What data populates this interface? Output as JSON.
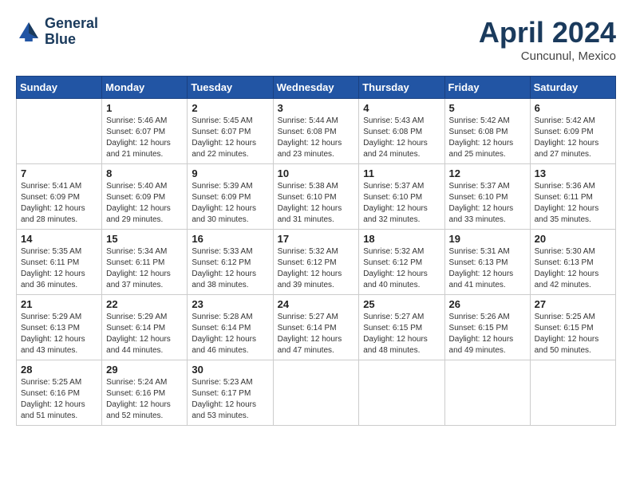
{
  "logo": {
    "line1": "General",
    "line2": "Blue"
  },
  "title": "April 2024",
  "subtitle": "Cuncunul, Mexico",
  "days_of_week": [
    "Sunday",
    "Monday",
    "Tuesday",
    "Wednesday",
    "Thursday",
    "Friday",
    "Saturday"
  ],
  "weeks": [
    [
      {
        "day": "",
        "sunrise": "",
        "sunset": "",
        "daylight": ""
      },
      {
        "day": "1",
        "sunrise": "Sunrise: 5:46 AM",
        "sunset": "Sunset: 6:07 PM",
        "daylight": "Daylight: 12 hours and 21 minutes."
      },
      {
        "day": "2",
        "sunrise": "Sunrise: 5:45 AM",
        "sunset": "Sunset: 6:07 PM",
        "daylight": "Daylight: 12 hours and 22 minutes."
      },
      {
        "day": "3",
        "sunrise": "Sunrise: 5:44 AM",
        "sunset": "Sunset: 6:08 PM",
        "daylight": "Daylight: 12 hours and 23 minutes."
      },
      {
        "day": "4",
        "sunrise": "Sunrise: 5:43 AM",
        "sunset": "Sunset: 6:08 PM",
        "daylight": "Daylight: 12 hours and 24 minutes."
      },
      {
        "day": "5",
        "sunrise": "Sunrise: 5:42 AM",
        "sunset": "Sunset: 6:08 PM",
        "daylight": "Daylight: 12 hours and 25 minutes."
      },
      {
        "day": "6",
        "sunrise": "Sunrise: 5:42 AM",
        "sunset": "Sunset: 6:09 PM",
        "daylight": "Daylight: 12 hours and 27 minutes."
      }
    ],
    [
      {
        "day": "7",
        "sunrise": "Sunrise: 5:41 AM",
        "sunset": "Sunset: 6:09 PM",
        "daylight": "Daylight: 12 hours and 28 minutes."
      },
      {
        "day": "8",
        "sunrise": "Sunrise: 5:40 AM",
        "sunset": "Sunset: 6:09 PM",
        "daylight": "Daylight: 12 hours and 29 minutes."
      },
      {
        "day": "9",
        "sunrise": "Sunrise: 5:39 AM",
        "sunset": "Sunset: 6:09 PM",
        "daylight": "Daylight: 12 hours and 30 minutes."
      },
      {
        "day": "10",
        "sunrise": "Sunrise: 5:38 AM",
        "sunset": "Sunset: 6:10 PM",
        "daylight": "Daylight: 12 hours and 31 minutes."
      },
      {
        "day": "11",
        "sunrise": "Sunrise: 5:37 AM",
        "sunset": "Sunset: 6:10 PM",
        "daylight": "Daylight: 12 hours and 32 minutes."
      },
      {
        "day": "12",
        "sunrise": "Sunrise: 5:37 AM",
        "sunset": "Sunset: 6:10 PM",
        "daylight": "Daylight: 12 hours and 33 minutes."
      },
      {
        "day": "13",
        "sunrise": "Sunrise: 5:36 AM",
        "sunset": "Sunset: 6:11 PM",
        "daylight": "Daylight: 12 hours and 35 minutes."
      }
    ],
    [
      {
        "day": "14",
        "sunrise": "Sunrise: 5:35 AM",
        "sunset": "Sunset: 6:11 PM",
        "daylight": "Daylight: 12 hours and 36 minutes."
      },
      {
        "day": "15",
        "sunrise": "Sunrise: 5:34 AM",
        "sunset": "Sunset: 6:11 PM",
        "daylight": "Daylight: 12 hours and 37 minutes."
      },
      {
        "day": "16",
        "sunrise": "Sunrise: 5:33 AM",
        "sunset": "Sunset: 6:12 PM",
        "daylight": "Daylight: 12 hours and 38 minutes."
      },
      {
        "day": "17",
        "sunrise": "Sunrise: 5:32 AM",
        "sunset": "Sunset: 6:12 PM",
        "daylight": "Daylight: 12 hours and 39 minutes."
      },
      {
        "day": "18",
        "sunrise": "Sunrise: 5:32 AM",
        "sunset": "Sunset: 6:12 PM",
        "daylight": "Daylight: 12 hours and 40 minutes."
      },
      {
        "day": "19",
        "sunrise": "Sunrise: 5:31 AM",
        "sunset": "Sunset: 6:13 PM",
        "daylight": "Daylight: 12 hours and 41 minutes."
      },
      {
        "day": "20",
        "sunrise": "Sunrise: 5:30 AM",
        "sunset": "Sunset: 6:13 PM",
        "daylight": "Daylight: 12 hours and 42 minutes."
      }
    ],
    [
      {
        "day": "21",
        "sunrise": "Sunrise: 5:29 AM",
        "sunset": "Sunset: 6:13 PM",
        "daylight": "Daylight: 12 hours and 43 minutes."
      },
      {
        "day": "22",
        "sunrise": "Sunrise: 5:29 AM",
        "sunset": "Sunset: 6:14 PM",
        "daylight": "Daylight: 12 hours and 44 minutes."
      },
      {
        "day": "23",
        "sunrise": "Sunrise: 5:28 AM",
        "sunset": "Sunset: 6:14 PM",
        "daylight": "Daylight: 12 hours and 46 minutes."
      },
      {
        "day": "24",
        "sunrise": "Sunrise: 5:27 AM",
        "sunset": "Sunset: 6:14 PM",
        "daylight": "Daylight: 12 hours and 47 minutes."
      },
      {
        "day": "25",
        "sunrise": "Sunrise: 5:27 AM",
        "sunset": "Sunset: 6:15 PM",
        "daylight": "Daylight: 12 hours and 48 minutes."
      },
      {
        "day": "26",
        "sunrise": "Sunrise: 5:26 AM",
        "sunset": "Sunset: 6:15 PM",
        "daylight": "Daylight: 12 hours and 49 minutes."
      },
      {
        "day": "27",
        "sunrise": "Sunrise: 5:25 AM",
        "sunset": "Sunset: 6:15 PM",
        "daylight": "Daylight: 12 hours and 50 minutes."
      }
    ],
    [
      {
        "day": "28",
        "sunrise": "Sunrise: 5:25 AM",
        "sunset": "Sunset: 6:16 PM",
        "daylight": "Daylight: 12 hours and 51 minutes."
      },
      {
        "day": "29",
        "sunrise": "Sunrise: 5:24 AM",
        "sunset": "Sunset: 6:16 PM",
        "daylight": "Daylight: 12 hours and 52 minutes."
      },
      {
        "day": "30",
        "sunrise": "Sunrise: 5:23 AM",
        "sunset": "Sunset: 6:17 PM",
        "daylight": "Daylight: 12 hours and 53 minutes."
      },
      {
        "day": "",
        "sunrise": "",
        "sunset": "",
        "daylight": ""
      },
      {
        "day": "",
        "sunrise": "",
        "sunset": "",
        "daylight": ""
      },
      {
        "day": "",
        "sunrise": "",
        "sunset": "",
        "daylight": ""
      },
      {
        "day": "",
        "sunrise": "",
        "sunset": "",
        "daylight": ""
      }
    ]
  ]
}
